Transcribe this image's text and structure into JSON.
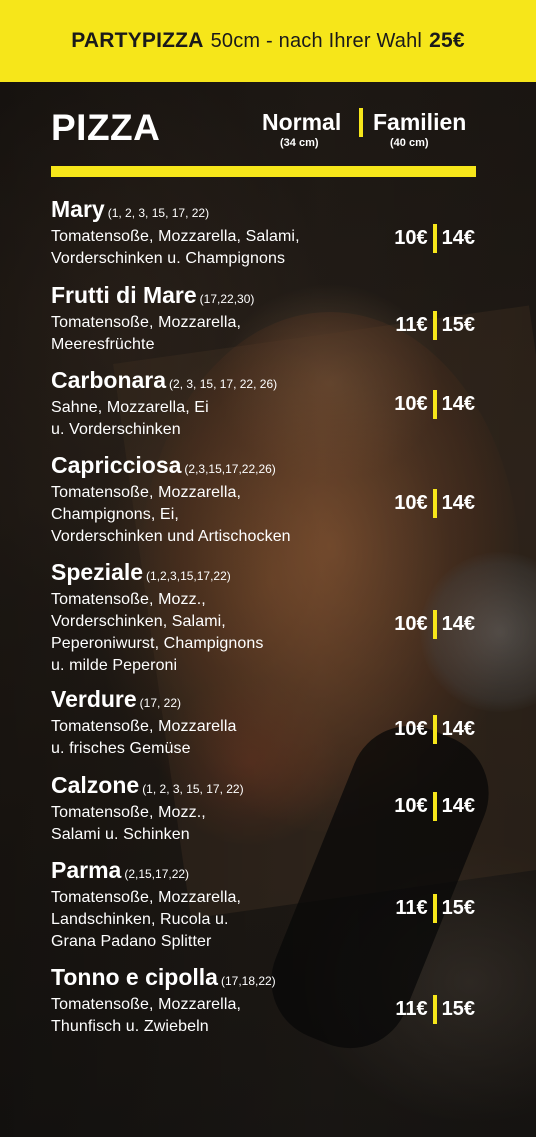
{
  "banner": {
    "name": "PARTYPIZZA",
    "text": "50cm - nach Ihrer Wahl",
    "price": "25€"
  },
  "menu": {
    "title": "PIZZA",
    "col_normal": "Normal",
    "col_normal_size": "(34 cm)",
    "col_family": "Familien",
    "col_family_size": "(40 cm)"
  },
  "colors": {
    "accent": "#f6e61a",
    "text": "#ffffff",
    "banner_text": "#1a1a1a"
  },
  "items": [
    {
      "name": "Mary",
      "codes": "(1, 2, 3, 15, 17, 22)",
      "desc": [
        "Tomatensoße, Mozzarella, Salami,",
        "Vorderschinken u. Champignons"
      ],
      "normal": "10€",
      "family": "14€"
    },
    {
      "name": "Frutti di Mare",
      "codes": "(17,22,30)",
      "desc": [
        "Tomatensoße, Mozzarella,",
        "Meeresfrüchte"
      ],
      "normal": "11€",
      "family": "15€"
    },
    {
      "name": "Carbonara",
      "codes": "(2, 3, 15, 17, 22, 26)",
      "desc": [
        "Sahne, Mozzarella, Ei",
        "u. Vorderschinken"
      ],
      "normal": "10€",
      "family": "14€"
    },
    {
      "name": "Capricciosa",
      "codes": "(2,3,15,17,22,26)",
      "desc": [
        "Tomatensoße, Mozzarella,",
        "Champignons, Ei,",
        "Vorderschinken und Artischocken"
      ],
      "normal": "10€",
      "family": "14€"
    },
    {
      "name": "Speziale",
      "codes": "(1,2,3,15,17,22)",
      "desc": [
        "Tomatensoße, Mozz.,",
        "Vorderschinken, Salami,",
        "Peperoniwurst, Champignons",
        "u. milde Peperoni"
      ],
      "normal": "10€",
      "family": "14€"
    },
    {
      "name": "Verdure",
      "codes": "(17, 22)",
      "desc": [
        "Tomatensoße, Mozzarella",
        "u. frisches Gemüse"
      ],
      "normal": "10€",
      "family": "14€"
    },
    {
      "name": "Calzone",
      "codes": "(1, 2, 3, 15, 17, 22)",
      "desc": [
        "Tomatensoße, Mozz.,",
        "Salami u. Schinken"
      ],
      "normal": "10€",
      "family": "14€"
    },
    {
      "name": "Parma",
      "codes": "(2,15,17,22)",
      "desc": [
        "Tomatensoße, Mozzarella,",
        "Landschinken, Rucola u.",
        "Grana Padano Splitter"
      ],
      "normal": "11€",
      "family": "15€"
    },
    {
      "name": "Tonno e cipolla",
      "codes": "(17,18,22)",
      "desc": [
        "Tomatensoße, Mozzarella,",
        "Thunfisch u. Zwiebeln"
      ],
      "normal": "11€",
      "family": "15€"
    }
  ]
}
